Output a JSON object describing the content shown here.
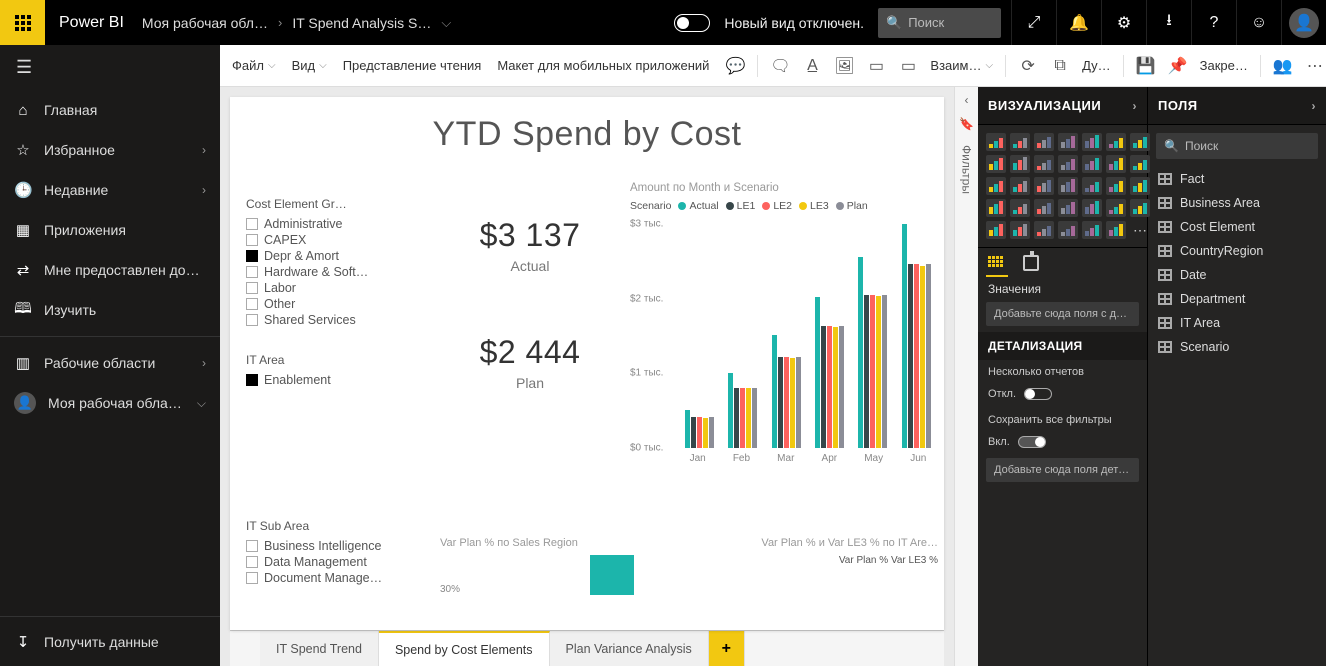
{
  "topbar": {
    "app_name": "Power BI",
    "breadcrumb_workspace": "Моя рабочая обл…",
    "breadcrumb_report": "IT Spend Analysis S…",
    "new_look_label": "Новый вид отключен.",
    "search_placeholder": "Поиск"
  },
  "sidebar": {
    "home": "Главная",
    "favorites": "Избранное",
    "recent": "Недавние",
    "apps": "Приложения",
    "shared": "Мне предоставлен доступ",
    "learn": "Изучить",
    "workspaces": "Рабочие области",
    "my_workspace": "Моя рабочая обла…",
    "get_data": "Получить данные"
  },
  "ribbon": {
    "file": "Файл",
    "view": "Вид",
    "reading_view": "Представление чтения",
    "mobile_layout": "Макет для мобильных приложений",
    "interactions": "Взаим…",
    "duplicate": "Ду…",
    "pin": "Закре…"
  },
  "filters_label": "Фильтры",
  "report": {
    "title": "YTD Spend by Cost",
    "slicer_cost_element_label": "Cost Element Gr…",
    "cost_elements": [
      {
        "name": "Administrative",
        "selected": false
      },
      {
        "name": "CAPEX",
        "selected": false
      },
      {
        "name": "Depr & Amort",
        "selected": true
      },
      {
        "name": "Hardware & Soft…",
        "selected": false
      },
      {
        "name": "Labor",
        "selected": false
      },
      {
        "name": "Other",
        "selected": false
      },
      {
        "name": "Shared Services",
        "selected": false
      }
    ],
    "slicer_it_area_label": "IT Area",
    "it_area": [
      {
        "name": "Enablement",
        "selected": true
      }
    ],
    "slicer_it_sub_label": "IT Sub Area",
    "it_sub_area": [
      {
        "name": "Business Intelligence",
        "selected": false
      },
      {
        "name": "Data Management",
        "selected": false
      },
      {
        "name": "Document Manage…",
        "selected": false
      }
    ],
    "kpi_actual_value": "$3 137",
    "kpi_actual_label": "Actual",
    "kpi_plan_value": "$2 444",
    "kpi_plan_label": "Plan",
    "chart_title": "Amount по Month и Scenario",
    "legend_label": "Scenario",
    "bottom_left_title": "Var Plan % по Sales Region",
    "bottom_left_axis": "30%",
    "bottom_right_title": "Var Plan % и Var LE3 % по IT Are…",
    "bottom_right_legend": [
      "Var Plan %",
      "Var LE3 %"
    ]
  },
  "chart_data": {
    "type": "bar",
    "title": "Amount по Month и Scenario",
    "ylabel": "Amount",
    "ylim": [
      0,
      3000
    ],
    "y_ticks": [
      "$3 тыс.",
      "$2 тыс.",
      "$1 тыс.",
      "$0 тыс."
    ],
    "categories": [
      "Jan",
      "Feb",
      "Mar",
      "Apr",
      "May",
      "Jun"
    ],
    "series": [
      {
        "name": "Actual",
        "color": "#1cb5ab",
        "values": [
          510,
          1010,
          1520,
          2020,
          2560,
          3140
        ]
      },
      {
        "name": "LE1",
        "color": "#374649",
        "values": [
          410,
          810,
          1220,
          1640,
          2050,
          2470
        ]
      },
      {
        "name": "LE2",
        "color": "#fd625e",
        "values": [
          410,
          810,
          1220,
          1640,
          2050,
          2470
        ]
      },
      {
        "name": "LE3",
        "color": "#f2c80f",
        "values": [
          400,
          800,
          1200,
          1620,
          2030,
          2440
        ]
      },
      {
        "name": "Plan",
        "color": "#8b8d97",
        "values": [
          410,
          810,
          1220,
          1640,
          2050,
          2470
        ]
      }
    ]
  },
  "viz_panel": {
    "title": "ВИЗУАЛИЗАЦИИ",
    "values_label": "Значения",
    "values_well": "Добавьте сюда поля с дан…",
    "drill_title": "ДЕТАЛИЗАЦИЯ",
    "cross_report_label": "Несколько отчетов",
    "cross_report_state": "Откл.",
    "keep_filters_label": "Сохранить все фильтры",
    "keep_filters_state": "Вкл.",
    "drill_well": "Добавьте сюда поля дета…"
  },
  "fields_panel": {
    "title": "ПОЛЯ",
    "search_placeholder": "Поиск",
    "tables": [
      "Fact",
      "Business Area",
      "Cost Element",
      "CountryRegion",
      "Date",
      "Department",
      "IT Area",
      "Scenario"
    ]
  },
  "tabs": {
    "trend": "IT Spend Trend",
    "cost": "Spend by Cost Elements",
    "variance": "Plan Variance Analysis"
  }
}
